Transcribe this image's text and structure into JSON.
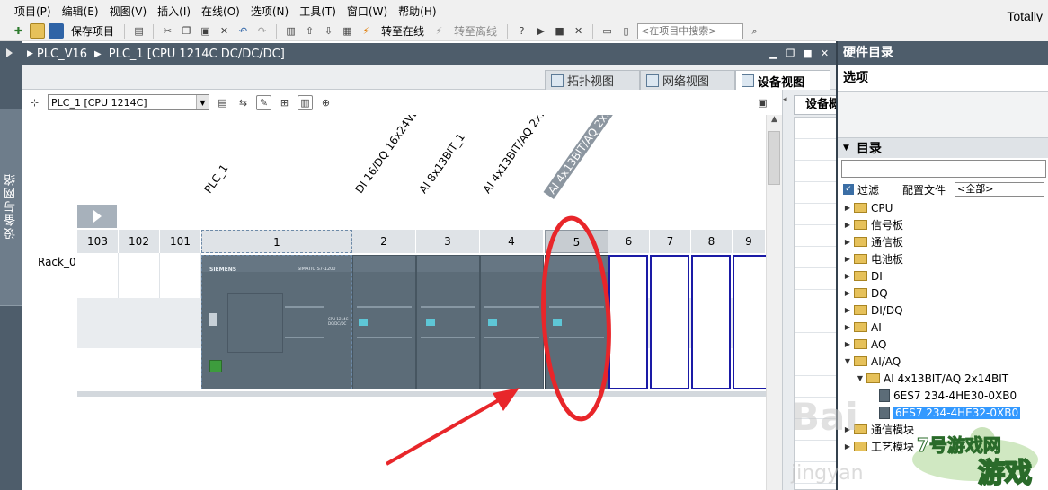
{
  "menubar": {
    "items": [
      "项目(P)",
      "编辑(E)",
      "视图(V)",
      "插入(I)",
      "在线(O)",
      "选项(N)",
      "工具(T)",
      "窗口(W)",
      "帮助(H)"
    ],
    "brand": "Totally"
  },
  "toolbar": {
    "save_project": "保存项目",
    "go_online": "转至在线",
    "go_offline": "转至离线",
    "search_placeholder": "<在项目中搜索>"
  },
  "left_strip": {
    "tab_label": "设备与网络"
  },
  "titlebar": {
    "project": "PLC_V16",
    "device": "PLC_1 [CPU 1214C DC/DC/DC]"
  },
  "view_tabs": [
    "拓扑视图",
    "网络视图",
    "设备视图"
  ],
  "device_selector": {
    "value": "PLC_1 [CPU 1214C]"
  },
  "rack": {
    "name": "Rack_0",
    "slots": [
      "103",
      "102",
      "101",
      "1",
      "2",
      "3",
      "4",
      "5",
      "6",
      "7",
      "8",
      "9"
    ],
    "module_labels": [
      "PLC_1",
      "DI 16/DQ 16x24VD...",
      "AI 8x13BIT_1",
      "AI 4x13BIT/AQ 2x...",
      "AI 4x13BIT/AQ 2x..."
    ],
    "module_brand": "SIEMENS",
    "cpu_print": "SIMATIC S7-1200",
    "cpu_model": "CPU 1214C DC/DC/DC"
  },
  "right_strip": {
    "tab_label": "设备概览"
  },
  "catalog": {
    "header": "硬件目录",
    "options": "选项",
    "section": "目录",
    "filter_label": "过滤",
    "profile_label": "配置文件",
    "profile_value": "<全部>",
    "tree": [
      {
        "label": "CPU",
        "level": 0,
        "expanded": false
      },
      {
        "label": "信号板",
        "level": 0,
        "expanded": false
      },
      {
        "label": "通信板",
        "level": 0,
        "expanded": false
      },
      {
        "label": "电池板",
        "level": 0,
        "expanded": false
      },
      {
        "label": "DI",
        "level": 0,
        "expanded": false
      },
      {
        "label": "DQ",
        "level": 0,
        "expanded": false
      },
      {
        "label": "DI/DQ",
        "level": 0,
        "expanded": false
      },
      {
        "label": "AI",
        "level": 0,
        "expanded": false
      },
      {
        "label": "AQ",
        "level": 0,
        "expanded": false
      },
      {
        "label": "AI/AQ",
        "level": 0,
        "expanded": true
      },
      {
        "label": "AI 4x13BIT/AQ 2x14BIT",
        "level": 1,
        "expanded": true
      },
      {
        "label": "6ES7 234-4HE30-0XB0",
        "level": 2,
        "device": true
      },
      {
        "label": "6ES7 234-4HE32-0XB0",
        "level": 2,
        "device": true,
        "selected": true
      },
      {
        "label": "通信模块",
        "level": 0,
        "expanded": false
      },
      {
        "label": "工艺模块",
        "level": 0,
        "expanded": false
      }
    ]
  },
  "watermarks": {
    "baidu": "Bai",
    "jingyan": "jingyan",
    "logo": "7号游戏网",
    "logo2": "游戏"
  },
  "colors": {
    "title_bg": "#4e5d6b",
    "module": "#5c6c78",
    "empty_slot_border": "#1a1aa6",
    "annotation": "#e8262a",
    "selection": "#3399ff"
  }
}
